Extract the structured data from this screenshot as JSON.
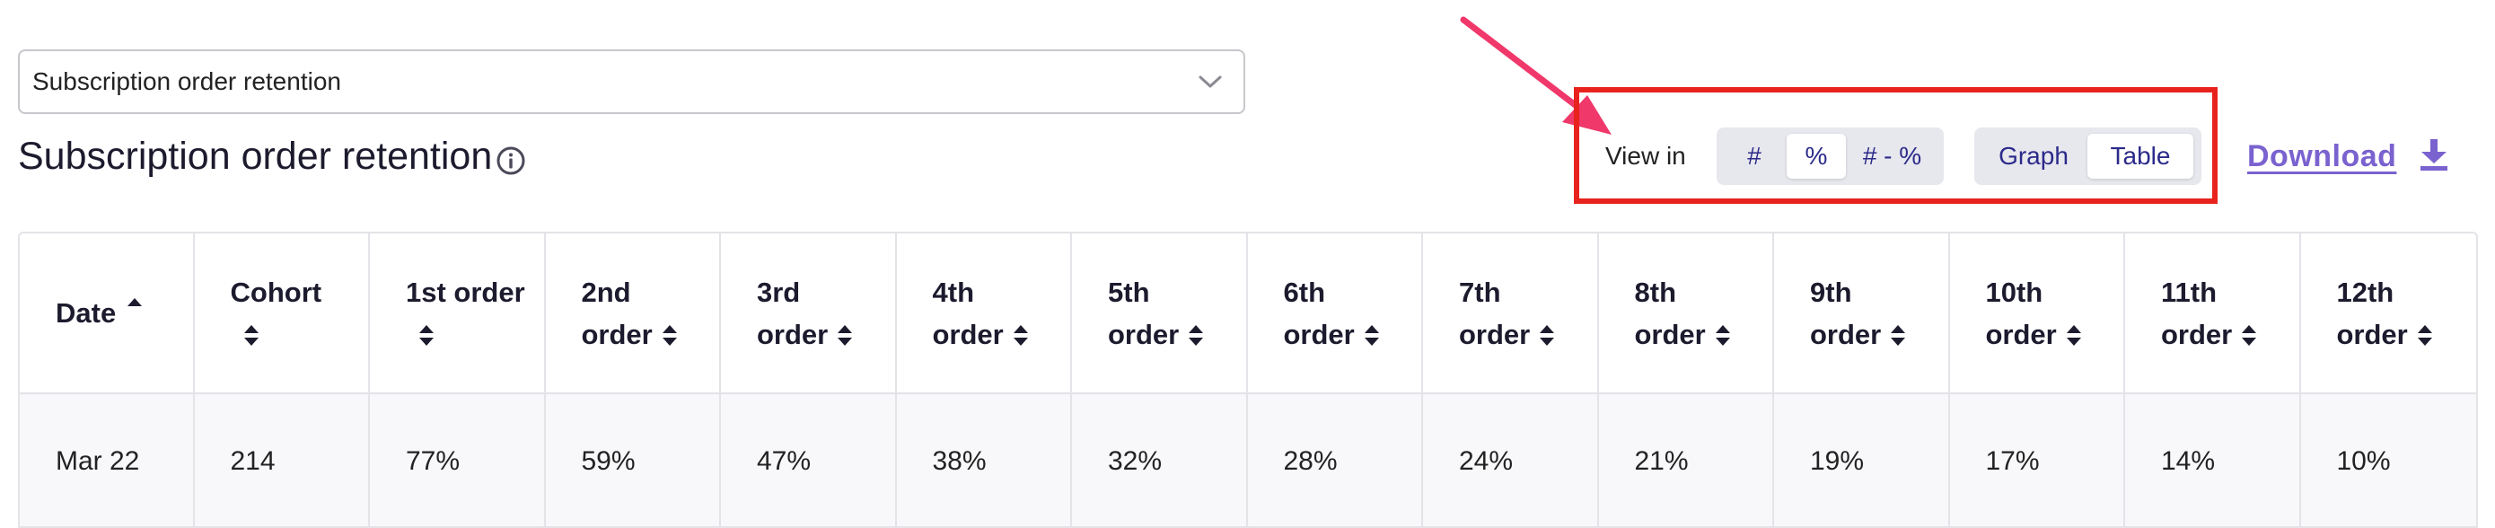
{
  "metric_select": {
    "value": "Subscription order retention"
  },
  "page_title": "Subscription order retention",
  "view_in_label": "View in",
  "view_modes": [
    {
      "label": "#",
      "active": false
    },
    {
      "label": "%",
      "active": true
    },
    {
      "label": "# - %",
      "active": false
    }
  ],
  "display_modes": [
    {
      "label": "Graph",
      "active": false
    },
    {
      "label": "Table",
      "active": true
    }
  ],
  "download_label": "Download",
  "colors": {
    "accent": "#7a62cf",
    "highlight_box": "#e8231e",
    "annotation_arrow": "#f0386b"
  },
  "table": {
    "columns": [
      {
        "line1": "Date",
        "line2": "",
        "sort": "asc"
      },
      {
        "line1": "Cohort",
        "line2": "",
        "sort": "both"
      },
      {
        "line1": "1st order",
        "line2": "",
        "sort": "both"
      },
      {
        "line1": "2nd",
        "line2": "order",
        "sort": "both"
      },
      {
        "line1": "3rd",
        "line2": "order",
        "sort": "both"
      },
      {
        "line1": "4th",
        "line2": "order",
        "sort": "both"
      },
      {
        "line1": "5th",
        "line2": "order",
        "sort": "both"
      },
      {
        "line1": "6th",
        "line2": "order",
        "sort": "both"
      },
      {
        "line1": "7th",
        "line2": "order",
        "sort": "both"
      },
      {
        "line1": "8th",
        "line2": "order",
        "sort": "both"
      },
      {
        "line1": "9th",
        "line2": "order",
        "sort": "both"
      },
      {
        "line1": "10th",
        "line2": "order",
        "sort": "both"
      },
      {
        "line1": "11th",
        "line2": "order",
        "sort": "both"
      },
      {
        "line1": "12th",
        "line2": "order",
        "sort": "both"
      }
    ],
    "rows": [
      [
        "Mar 22",
        "214",
        "77%",
        "59%",
        "47%",
        "38%",
        "32%",
        "28%",
        "24%",
        "21%",
        "19%",
        "17%",
        "14%",
        "10%"
      ]
    ]
  }
}
